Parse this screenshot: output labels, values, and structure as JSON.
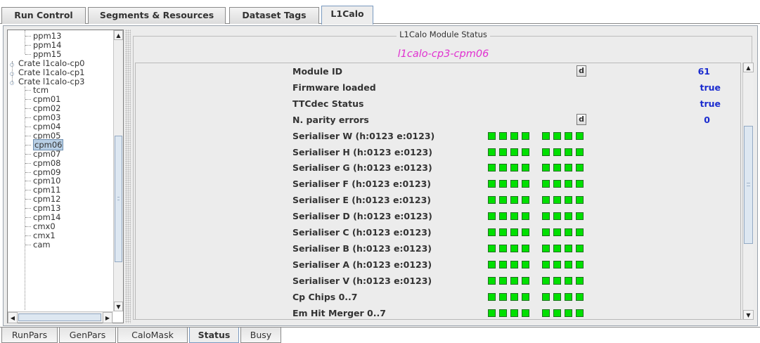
{
  "top_tabs": [
    {
      "label": "Run Control"
    },
    {
      "label": "Segments & Resources"
    },
    {
      "label": "Dataset Tags"
    },
    {
      "label": "L1Calo"
    }
  ],
  "tree": {
    "items": [
      {
        "label": "ppm13",
        "kind": "leaf"
      },
      {
        "label": "ppm14",
        "kind": "leaf"
      },
      {
        "label": "ppm15",
        "kind": "leaf"
      },
      {
        "label": "Crate l1calo-cp0",
        "kind": "crate",
        "expanded": false
      },
      {
        "label": "Crate l1calo-cp1",
        "kind": "crate",
        "expanded": false
      },
      {
        "label": "Crate l1calo-cp3",
        "kind": "crate",
        "expanded": true
      },
      {
        "label": "tcm",
        "kind": "leaf"
      },
      {
        "label": "cpm01",
        "kind": "leaf"
      },
      {
        "label": "cpm02",
        "kind": "leaf"
      },
      {
        "label": "cpm03",
        "kind": "leaf"
      },
      {
        "label": "cpm04",
        "kind": "leaf"
      },
      {
        "label": "cpm05",
        "kind": "leaf"
      },
      {
        "label": "cpm06",
        "kind": "leaf",
        "selected": true
      },
      {
        "label": "cpm07",
        "kind": "leaf"
      },
      {
        "label": "cpm08",
        "kind": "leaf"
      },
      {
        "label": "cpm09",
        "kind": "leaf"
      },
      {
        "label": "cpm10",
        "kind": "leaf"
      },
      {
        "label": "cpm11",
        "kind": "leaf"
      },
      {
        "label": "cpm12",
        "kind": "leaf"
      },
      {
        "label": "cpm13",
        "kind": "leaf"
      },
      {
        "label": "cpm14",
        "kind": "leaf"
      },
      {
        "label": "cmx0",
        "kind": "leaf"
      },
      {
        "label": "cmx1",
        "kind": "leaf"
      },
      {
        "label": "cam",
        "kind": "leaf"
      }
    ]
  },
  "status_panel": {
    "title": "L1Calo Module Status",
    "module_name": "l1calo-cp3-cpm06",
    "led_color": "#00e000",
    "rows": [
      {
        "label": "Module ID",
        "value": "61",
        "button": "d"
      },
      {
        "label": "Firmware loaded",
        "value": "true"
      },
      {
        "label": "TTCdec Status",
        "value": "true"
      },
      {
        "label": "N. parity errors",
        "value": "0",
        "button": "d"
      },
      {
        "label": "Serialiser W (h:0123 e:0123)",
        "leds": 8
      },
      {
        "label": "Serialiser H (h:0123 e:0123)",
        "leds": 8
      },
      {
        "label": "Serialiser G (h:0123 e:0123)",
        "leds": 8
      },
      {
        "label": "Serialiser F (h:0123 e:0123)",
        "leds": 8
      },
      {
        "label": "Serialiser E (h:0123 e:0123)",
        "leds": 8
      },
      {
        "label": "Serialiser D (h:0123 e:0123)",
        "leds": 8
      },
      {
        "label": "Serialiser C (h:0123 e:0123)",
        "leds": 8
      },
      {
        "label": "Serialiser B (h:0123 e:0123)",
        "leds": 8
      },
      {
        "label": "Serialiser A (h:0123 e:0123)",
        "leds": 8
      },
      {
        "label": "Serialiser V (h:0123 e:0123)",
        "leds": 8
      },
      {
        "label": "Cp Chips 0..7",
        "leds": 8
      },
      {
        "label": "Em Hit Merger 0..7",
        "leds": 8
      }
    ]
  },
  "bottom_tabs": [
    {
      "label": "RunPars"
    },
    {
      "label": "GenPars"
    },
    {
      "label": "CaloMask"
    },
    {
      "label": "Status"
    },
    {
      "label": "Busy"
    }
  ]
}
